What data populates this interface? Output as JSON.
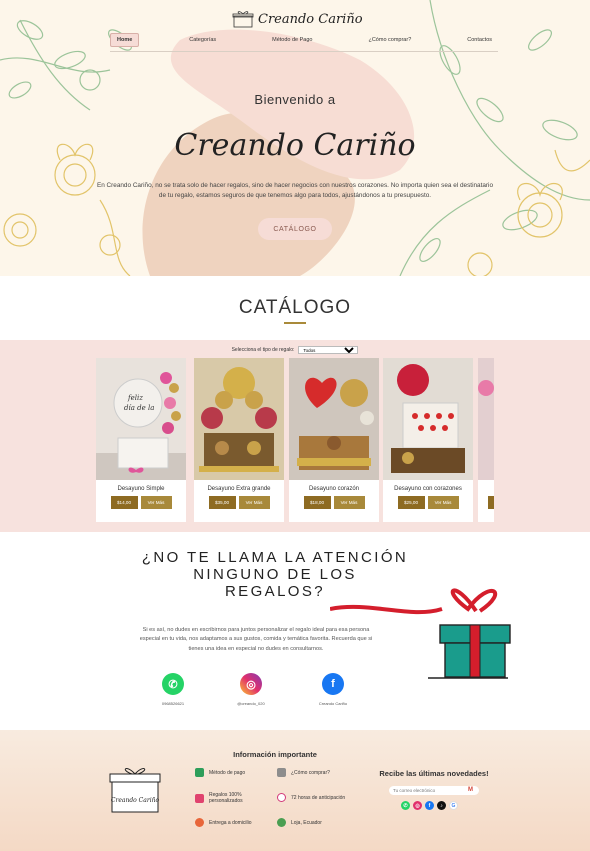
{
  "brand": {
    "name": "Creando Cariño"
  },
  "nav": [
    {
      "label": "Home",
      "active": true
    },
    {
      "label": "Categorías",
      "active": false
    },
    {
      "label": "Método de Pago",
      "active": false
    },
    {
      "label": "¿Cómo comprar?",
      "active": false
    },
    {
      "label": "Contactos",
      "active": false
    }
  ],
  "hero": {
    "welcome": "Bienvenido a",
    "title": "Creando Cariño",
    "description": "En Creando Cariño, no se trata solo de hacer regalos, sino de hacer negocios con nuestros corazones. No importa quien sea el destinatario de tu regalo, estamos seguros de que tenemos algo para todos, ajustándonos a tu presupuesto.",
    "button": "CATÁLOGO"
  },
  "catalog": {
    "title": "CATÁLOGO",
    "filter_label": "Selecciona el tipo de regalo:",
    "filter_value": "Todos",
    "more_label": "Ver Más",
    "products": [
      {
        "name": "Desayuno Simple",
        "price": "$14,00"
      },
      {
        "name": "Desayuno Extra grande",
        "price": "$35,00"
      },
      {
        "name": "Desayuno corazón",
        "price": "$18,00"
      },
      {
        "name": "Desayuno con corazones",
        "price": "$25,00"
      }
    ]
  },
  "no_gift": {
    "title": "¿NO TE LLAMA LA ATENCIÓN NINGUNO DE LOS REGALOS?",
    "description": "Si es así, no dudes en escribirnos para juntos personalizar el regalo ideal para esa persona especial en tu vida, nos adaptamos a sus gustos, comida y temática favorita. Recuerda que si tienes una idea en especial no dudes en consultarnos.",
    "contacts": [
      {
        "icon": "whatsapp-icon",
        "label": "0968526621",
        "color": "#25d366"
      },
      {
        "icon": "instagram-icon",
        "label": "@creando_020",
        "color": "#d6249f"
      },
      {
        "icon": "facebook-icon",
        "label": "Creando Cariño",
        "color": "#1877f2"
      }
    ]
  },
  "footer": {
    "info_title": "Información importante",
    "items": [
      {
        "label": "Método de pago",
        "icon": "money-icon"
      },
      {
        "label": "¿Cómo comprar?",
        "icon": "document-icon"
      },
      {
        "label": "Regalos 100% personalizados",
        "icon": "gift-icon"
      },
      {
        "label": "72 horas de anticipación",
        "icon": "clock-icon"
      },
      {
        "label": "Entrega a domicilio",
        "icon": "delivery-icon"
      },
      {
        "label": "Loja, Ecuador",
        "icon": "location-icon"
      }
    ],
    "newsletter_title": "Recibe las últimas novedades!",
    "email_placeholder": "Tu correo electrónico",
    "logo_text": "Creando Cariño"
  }
}
